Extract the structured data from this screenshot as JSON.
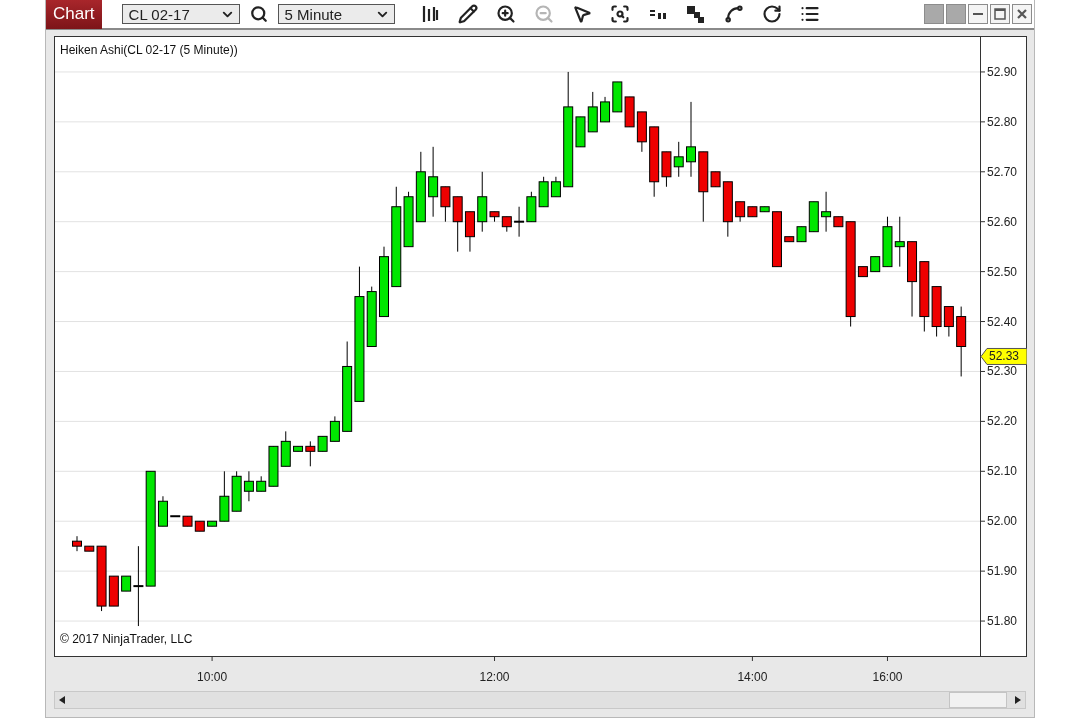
{
  "toolbar": {
    "title": "Chart",
    "instrument": "CL 02-17",
    "interval": "5 Minute",
    "tools": [
      {
        "kind": "bars",
        "disabled": false
      },
      {
        "kind": "pencil",
        "disabled": false
      },
      {
        "kind": "zoom-in",
        "disabled": false
      },
      {
        "kind": "zoom-out",
        "disabled": true
      },
      {
        "kind": "pointer",
        "disabled": false
      },
      {
        "kind": "data-box",
        "disabled": false
      },
      {
        "kind": "series",
        "disabled": false
      },
      {
        "kind": "steps",
        "disabled": false
      },
      {
        "kind": "spline",
        "disabled": false
      },
      {
        "kind": "refresh",
        "disabled": false
      },
      {
        "kind": "list",
        "disabled": false
      }
    ]
  },
  "chart": {
    "label": "Heiken Ashi(CL 02-17 (5 Minute))",
    "copyright": "© 2017 NinjaTrader, LLC",
    "price_marker": "52.33",
    "chart_data": {
      "type": "candlestick",
      "grid": true,
      "ylim": [
        51.73,
        52.97
      ],
      "yticks": [
        {
          "value": 52.9,
          "label": "52.90"
        },
        {
          "value": 52.8,
          "label": "52.80"
        },
        {
          "value": 52.7,
          "label": "52.70"
        },
        {
          "value": 52.6,
          "label": "52.60"
        },
        {
          "value": 52.5,
          "label": "52.50"
        },
        {
          "value": 52.4,
          "label": "52.40"
        },
        {
          "value": 52.3,
          "label": "52.30"
        },
        {
          "value": 52.2,
          "label": "52.20"
        },
        {
          "value": 52.1,
          "label": "52.10"
        },
        {
          "value": 52.0,
          "label": "52.00"
        },
        {
          "value": 51.9,
          "label": "51.90"
        },
        {
          "value": 51.8,
          "label": "51.80"
        }
      ],
      "categories": [
        null,
        null,
        null,
        null,
        null,
        null,
        null,
        null,
        null,
        null,
        null,
        "10:00",
        null,
        null,
        null,
        null,
        null,
        null,
        null,
        null,
        null,
        null,
        null,
        null,
        null,
        null,
        null,
        null,
        null,
        null,
        null,
        null,
        null,
        null,
        "12:00",
        null,
        null,
        null,
        null,
        null,
        null,
        null,
        null,
        null,
        null,
        null,
        null,
        null,
        null,
        null,
        null,
        null,
        null,
        null,
        null,
        "14:00",
        null,
        null,
        null,
        null,
        null,
        null,
        null,
        null,
        null,
        null,
        "16:00",
        null,
        null,
        null,
        null,
        null,
        null
      ],
      "ohlc": [
        [
          51.96,
          51.97,
          51.94,
          51.95
        ],
        [
          51.95,
          51.95,
          51.94,
          51.94
        ],
        [
          51.95,
          51.95,
          51.82,
          51.83
        ],
        [
          51.89,
          51.89,
          51.83,
          51.83
        ],
        [
          51.86,
          51.89,
          51.86,
          51.89
        ],
        [
          51.87,
          51.95,
          51.79,
          51.87
        ],
        [
          51.87,
          52.1,
          51.87,
          52.1
        ],
        [
          51.99,
          52.05,
          51.99,
          52.04
        ],
        [
          52.01,
          52.01,
          52.01,
          52.01
        ],
        [
          52.01,
          52.01,
          51.99,
          51.99
        ],
        [
          52.0,
          52.0,
          51.98,
          51.98
        ],
        [
          51.99,
          52.0,
          51.99,
          52.0
        ],
        [
          52.0,
          52.1,
          52.0,
          52.05
        ],
        [
          52.02,
          52.1,
          52.02,
          52.09
        ],
        [
          52.06,
          52.1,
          52.04,
          52.08
        ],
        [
          52.06,
          52.09,
          52.06,
          52.08
        ],
        [
          52.07,
          52.15,
          52.07,
          52.15
        ],
        [
          52.11,
          52.18,
          52.11,
          52.16
        ],
        [
          52.14,
          52.15,
          52.14,
          52.15
        ],
        [
          52.15,
          52.16,
          52.11,
          52.14
        ],
        [
          52.14,
          52.17,
          52.14,
          52.17
        ],
        [
          52.16,
          52.21,
          52.16,
          52.2
        ],
        [
          52.18,
          52.36,
          52.18,
          52.31
        ],
        [
          52.24,
          52.51,
          52.24,
          52.45
        ],
        [
          52.35,
          52.47,
          52.35,
          52.46
        ],
        [
          52.41,
          52.55,
          52.41,
          52.53
        ],
        [
          52.47,
          52.67,
          52.47,
          52.63
        ],
        [
          52.55,
          52.66,
          52.55,
          52.65
        ],
        [
          52.6,
          52.74,
          52.6,
          52.7
        ],
        [
          52.65,
          52.75,
          52.61,
          52.69
        ],
        [
          52.67,
          52.67,
          52.6,
          52.63
        ],
        [
          52.65,
          52.65,
          52.54,
          52.6
        ],
        [
          52.62,
          52.62,
          52.54,
          52.57
        ],
        [
          52.6,
          52.7,
          52.58,
          52.65
        ],
        [
          52.62,
          52.62,
          52.6,
          52.61
        ],
        [
          52.61,
          52.61,
          52.58,
          52.59
        ],
        [
          52.6,
          52.63,
          52.57,
          52.6
        ],
        [
          52.6,
          52.66,
          52.6,
          52.65
        ],
        [
          52.63,
          52.69,
          52.63,
          52.68
        ],
        [
          52.65,
          52.69,
          52.65,
          52.68
        ],
        [
          52.67,
          52.9,
          52.67,
          52.83
        ],
        [
          52.75,
          52.81,
          52.75,
          52.81
        ],
        [
          52.78,
          52.86,
          52.78,
          52.83
        ],
        [
          52.8,
          52.85,
          52.8,
          52.84
        ],
        [
          52.82,
          52.88,
          52.82,
          52.88
        ],
        [
          52.85,
          52.85,
          52.79,
          52.79
        ],
        [
          52.82,
          52.82,
          52.74,
          52.76
        ],
        [
          52.79,
          52.79,
          52.65,
          52.68
        ],
        [
          52.74,
          52.74,
          52.67,
          52.69
        ],
        [
          52.71,
          52.76,
          52.69,
          52.73
        ],
        [
          52.72,
          52.84,
          52.69,
          52.75
        ],
        [
          52.74,
          52.74,
          52.6,
          52.66
        ],
        [
          52.7,
          52.7,
          52.67,
          52.67
        ],
        [
          52.68,
          52.68,
          52.57,
          52.6
        ],
        [
          52.64,
          52.64,
          52.6,
          52.61
        ],
        [
          52.63,
          52.63,
          52.61,
          52.61
        ],
        [
          52.62,
          52.63,
          52.62,
          52.63
        ],
        [
          52.62,
          52.62,
          52.51,
          52.51
        ],
        [
          52.57,
          52.57,
          52.56,
          52.56
        ],
        [
          52.56,
          52.59,
          52.56,
          52.59
        ],
        [
          52.58,
          52.64,
          52.58,
          52.64
        ],
        [
          52.61,
          52.66,
          52.58,
          52.62
        ],
        [
          52.61,
          52.61,
          52.59,
          52.59
        ],
        [
          52.6,
          52.6,
          52.39,
          52.41
        ],
        [
          52.51,
          52.51,
          52.49,
          52.49
        ],
        [
          52.5,
          52.53,
          52.5,
          52.53
        ],
        [
          52.51,
          52.61,
          52.51,
          52.59
        ],
        [
          52.55,
          52.61,
          52.51,
          52.56
        ],
        [
          52.56,
          52.56,
          52.41,
          52.48
        ],
        [
          52.52,
          52.52,
          52.38,
          52.41
        ],
        [
          52.47,
          52.47,
          52.37,
          52.39
        ],
        [
          52.43,
          52.43,
          52.37,
          52.39
        ],
        [
          52.41,
          52.43,
          52.29,
          52.35
        ]
      ]
    }
  }
}
